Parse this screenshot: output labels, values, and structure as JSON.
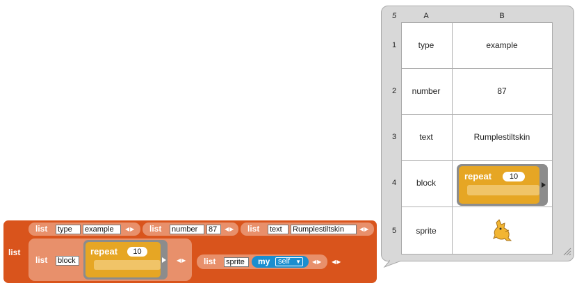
{
  "table_view": {
    "row_count": "5",
    "columns": [
      "A",
      "B"
    ],
    "rows": [
      {
        "num": "1",
        "a": "type",
        "b": "example"
      },
      {
        "num": "2",
        "a": "number",
        "b": "87"
      },
      {
        "num": "3",
        "a": "text",
        "b": "Rumplestiltskin"
      },
      {
        "num": "4",
        "a": "block",
        "b_block": {
          "keyword": "repeat",
          "count": "10"
        }
      },
      {
        "num": "5",
        "a": "sprite",
        "b_icon": "sprite-costume-icon"
      }
    ]
  },
  "script": {
    "outer_label": "list",
    "items": [
      {
        "label": "list",
        "slots": [
          "type",
          "example"
        ]
      },
      {
        "label": "list",
        "slots": [
          "number",
          "87"
        ]
      },
      {
        "label": "list",
        "slots": [
          "text",
          "Rumplestiltskin"
        ]
      },
      {
        "label": "list",
        "slots": [
          "block"
        ],
        "repeat": {
          "keyword": "repeat",
          "count": "10"
        }
      },
      {
        "label": "list",
        "slots": [
          "sprite"
        ],
        "reporter": {
          "keyword": "my",
          "option": "self"
        }
      }
    ]
  },
  "colors": {
    "list_outer": "#d9541c",
    "list_inner": "#e8906b",
    "control": "#e6a624",
    "sensing": "#1a8ecf",
    "table_bg": "#d8d8d8"
  }
}
